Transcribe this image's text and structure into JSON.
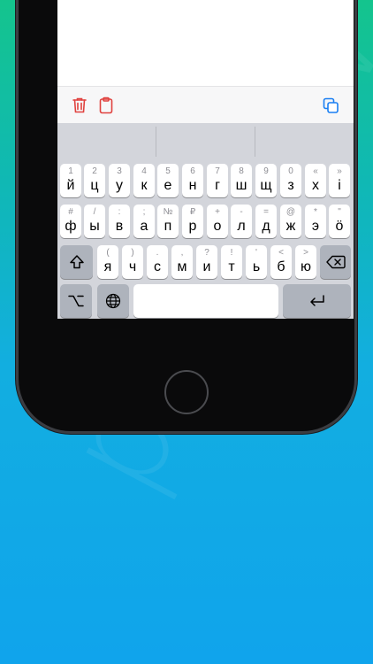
{
  "watermark": {
    "text": "preview"
  },
  "toolbar": {
    "trash_icon": "trash-icon",
    "clipboard_icon": "clipboard-icon",
    "copy_icon": "copy-icon",
    "accent_red": "#e0413e",
    "accent_blue": "#1a7ff2"
  },
  "keyboard": {
    "row1": [
      {
        "sym": "1",
        "ch": "й"
      },
      {
        "sym": "2",
        "ch": "ц"
      },
      {
        "sym": "3",
        "ch": "у"
      },
      {
        "sym": "4",
        "ch": "к"
      },
      {
        "sym": "5",
        "ch": "е"
      },
      {
        "sym": "6",
        "ch": "н"
      },
      {
        "sym": "7",
        "ch": "г"
      },
      {
        "sym": "8",
        "ch": "ш"
      },
      {
        "sym": "9",
        "ch": "щ"
      },
      {
        "sym": "0",
        "ch": "з"
      },
      {
        "sym": "«",
        "ch": "х"
      },
      {
        "sym": "»",
        "ch": "і"
      }
    ],
    "row2": [
      {
        "sym": "#",
        "ch": "ф"
      },
      {
        "sym": "/",
        "ch": "ы"
      },
      {
        "sym": ":",
        "ch": "в"
      },
      {
        "sym": ";",
        "ch": "а"
      },
      {
        "sym": "№",
        "ch": "п"
      },
      {
        "sym": "₽",
        "ch": "р"
      },
      {
        "sym": "+",
        "ch": "о"
      },
      {
        "sym": "-",
        "ch": "л"
      },
      {
        "sym": "=",
        "ch": "д"
      },
      {
        "sym": "@",
        "ch": "ж"
      },
      {
        "sym": "*",
        "ch": "э"
      },
      {
        "sym": "\"",
        "ch": "ö"
      }
    ],
    "row3": [
      {
        "sym": "(",
        "ch": "я"
      },
      {
        "sym": ")",
        "ch": "ч"
      },
      {
        "sym": ".",
        "ch": "с"
      },
      {
        "sym": ",",
        "ch": "м"
      },
      {
        "sym": "?",
        "ch": "и"
      },
      {
        "sym": "!",
        "ch": "т"
      },
      {
        "sym": "'",
        "ch": "ь"
      },
      {
        "sym": "<",
        "ch": "б"
      },
      {
        "sym": ">",
        "ch": "ю"
      }
    ],
    "shift_icon": "shift-icon",
    "delete_icon": "delete-icon",
    "option_icon": "option-icon",
    "globe_icon": "globe-icon",
    "return_icon": "return-icon",
    "space_label": ""
  }
}
